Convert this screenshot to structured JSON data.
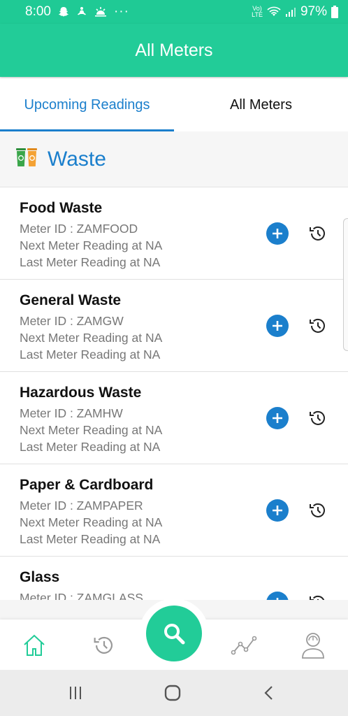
{
  "status_bar": {
    "time": "8:00",
    "more": "···",
    "volte": "Vo)\nLTE",
    "battery": "97%"
  },
  "app_bar": {
    "title": "All Meters"
  },
  "tabs": [
    {
      "label": "Upcoming Readings",
      "active": true
    },
    {
      "label": "All Meters",
      "active": false
    }
  ],
  "section": {
    "title": "Waste",
    "icon": "recycle-bins-icon"
  },
  "meters": [
    {
      "name": "Food Waste",
      "meter_id": "Meter ID : ZAMFOOD",
      "next": "Next Meter Reading at NA",
      "last": "Last Meter Reading at NA"
    },
    {
      "name": "General Waste",
      "meter_id": "Meter ID : ZAMGW",
      "next": "Next Meter Reading at NA",
      "last": "Last Meter Reading at NA"
    },
    {
      "name": "Hazardous Waste",
      "meter_id": "Meter ID : ZAMHW",
      "next": "Next Meter Reading at NA",
      "last": "Last Meter Reading at NA"
    },
    {
      "name": "Paper & Cardboard",
      "meter_id": "Meter ID : ZAMPAPER",
      "next": "Next Meter Reading at NA",
      "last": "Last Meter Reading at NA"
    },
    {
      "name": "Glass",
      "meter_id": "Meter ID : ZAMGLASS",
      "next": "",
      "last": ""
    }
  ],
  "bottom_nav": [
    "home-icon",
    "history-icon",
    "search-icon",
    "analytics-icon",
    "profile-icon"
  ],
  "colors": {
    "primary": "#22cc98",
    "accent": "#1b7fcc"
  }
}
